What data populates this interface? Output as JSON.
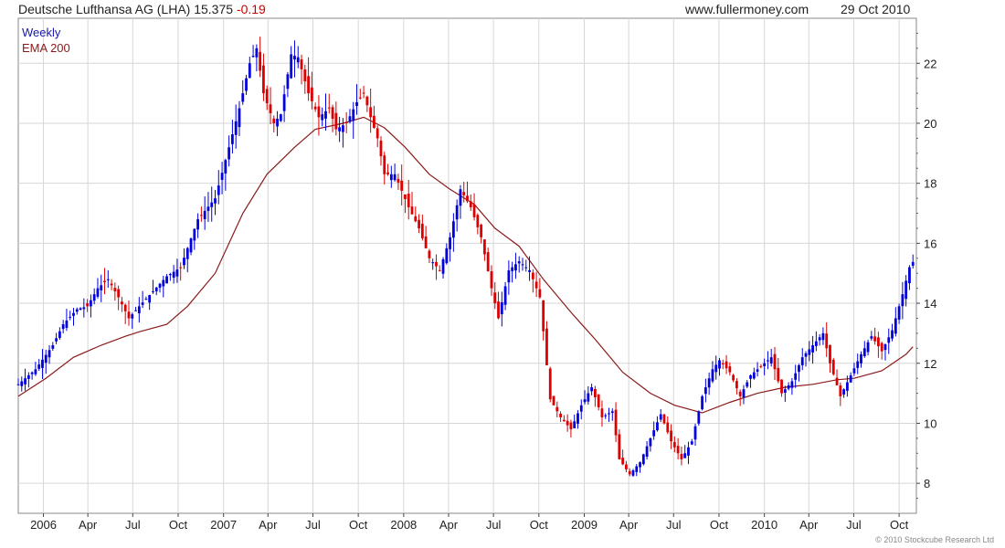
{
  "header": {
    "name": "Deutsche Lufthansa AG (LHA)",
    "price": "15.375",
    "change": "-0.19",
    "site": "www.fullermoney.com",
    "date": "29 Oct 2010"
  },
  "legend": {
    "weekly": "Weekly",
    "ema": "EMA 200"
  },
  "copyright": "© 2010 Stockcube Research Ltd",
  "colors": {
    "up": "#0000dd",
    "down": "#dd0000",
    "ema": "#8b1a1a",
    "grid": "#d6d6d6",
    "frame": "#888888"
  },
  "chart_data": {
    "type": "candlestick",
    "x_range": [
      "2005-11-11",
      "2010-11-05"
    ],
    "ylim": [
      7,
      23.5
    ],
    "y_ticks": [
      8,
      10,
      12,
      14,
      16,
      18,
      20,
      22
    ],
    "x_ticks": [
      {
        "label": "2006",
        "date": "2006-01-01"
      },
      {
        "label": "Apr",
        "date": "2006-04-01"
      },
      {
        "label": "Jul",
        "date": "2006-07-01"
      },
      {
        "label": "Oct",
        "date": "2006-10-01"
      },
      {
        "label": "2007",
        "date": "2007-01-01"
      },
      {
        "label": "Apr",
        "date": "2007-04-01"
      },
      {
        "label": "Jul",
        "date": "2007-07-01"
      },
      {
        "label": "Oct",
        "date": "2007-10-01"
      },
      {
        "label": "2008",
        "date": "2008-01-01"
      },
      {
        "label": "Apr",
        "date": "2008-04-01"
      },
      {
        "label": "Jul",
        "date": "2008-07-01"
      },
      {
        "label": "Oct",
        "date": "2008-10-01"
      },
      {
        "label": "2009",
        "date": "2009-01-01"
      },
      {
        "label": "Apr",
        "date": "2009-04-01"
      },
      {
        "label": "Jul",
        "date": "2009-07-01"
      },
      {
        "label": "Oct",
        "date": "2009-10-01"
      },
      {
        "label": "2010",
        "date": "2010-01-01"
      },
      {
        "label": "Apr",
        "date": "2010-04-01"
      },
      {
        "label": "Jul",
        "date": "2010-07-01"
      },
      {
        "label": "Oct",
        "date": "2010-10-01"
      }
    ],
    "price_path": [
      [
        "2005-11-11",
        11.3
      ],
      [
        "2005-12-16",
        11.8
      ],
      [
        "2006-01-20",
        12.6
      ],
      [
        "2006-02-10",
        13.3
      ],
      [
        "2006-03-10",
        13.8
      ],
      [
        "2006-03-31",
        13.9
      ],
      [
        "2006-04-21",
        14.5
      ],
      [
        "2006-05-12",
        14.8
      ],
      [
        "2006-06-02",
        14.2
      ],
      [
        "2006-06-23",
        13.5
      ],
      [
        "2006-07-14",
        13.9
      ],
      [
        "2006-08-11",
        14.4
      ],
      [
        "2006-09-08",
        14.9
      ],
      [
        "2006-10-06",
        15.2
      ],
      [
        "2006-11-10",
        16.8
      ],
      [
        "2006-12-15",
        17.5
      ],
      [
        "2007-01-12",
        19.2
      ],
      [
        "2007-02-02",
        20.5
      ],
      [
        "2007-02-23",
        22.0
      ],
      [
        "2007-03-09",
        22.5
      ],
      [
        "2007-03-23",
        21.0
      ],
      [
        "2007-04-13",
        20.0
      ],
      [
        "2007-04-27",
        20.3
      ],
      [
        "2007-05-18",
        22.3
      ],
      [
        "2007-06-01",
        22.2
      ],
      [
        "2007-06-22",
        21.0
      ],
      [
        "2007-07-13",
        20.2
      ],
      [
        "2007-08-03",
        20.5
      ],
      [
        "2007-08-17",
        19.8
      ],
      [
        "2007-09-07",
        20.0
      ],
      [
        "2007-09-28",
        20.7
      ],
      [
        "2007-10-12",
        21.0
      ],
      [
        "2007-10-26",
        20.2
      ],
      [
        "2007-11-09",
        19.5
      ],
      [
        "2007-11-23",
        18.3
      ],
      [
        "2007-12-14",
        18.3
      ],
      [
        "2008-01-11",
        17.2
      ],
      [
        "2008-02-01",
        16.5
      ],
      [
        "2008-02-22",
        15.5
      ],
      [
        "2008-03-14",
        15.1
      ],
      [
        "2008-04-04",
        16.2
      ],
      [
        "2008-04-25",
        17.8
      ],
      [
        "2008-05-16",
        17.2
      ],
      [
        "2008-06-06",
        16.2
      ],
      [
        "2008-06-27",
        14.5
      ],
      [
        "2008-07-11",
        13.5
      ],
      [
        "2008-08-01",
        15.1
      ],
      [
        "2008-08-22",
        15.4
      ],
      [
        "2008-09-12",
        15.1
      ],
      [
        "2008-10-03",
        14.2
      ],
      [
        "2008-10-24",
        10.8
      ],
      [
        "2008-11-14",
        10.2
      ],
      [
        "2008-12-05",
        9.8
      ],
      [
        "2008-12-26",
        10.6
      ],
      [
        "2009-01-16",
        11.2
      ],
      [
        "2009-02-06",
        10.2
      ],
      [
        "2009-02-27",
        10.4
      ],
      [
        "2009-03-13",
        8.8
      ],
      [
        "2009-04-03",
        8.3
      ],
      [
        "2009-04-24",
        8.7
      ],
      [
        "2009-05-15",
        9.5
      ],
      [
        "2009-06-05",
        10.3
      ],
      [
        "2009-06-26",
        9.4
      ],
      [
        "2009-07-17",
        8.8
      ],
      [
        "2009-08-07",
        9.4
      ],
      [
        "2009-08-28",
        10.9
      ],
      [
        "2009-09-18",
        11.8
      ],
      [
        "2009-10-02",
        12.1
      ],
      [
        "2009-10-23",
        11.7
      ],
      [
        "2009-11-13",
        10.9
      ],
      [
        "2009-12-04",
        11.6
      ],
      [
        "2009-12-25",
        11.9
      ],
      [
        "2010-01-15",
        12.2
      ],
      [
        "2010-02-05",
        11.0
      ],
      [
        "2010-02-26",
        11.4
      ],
      [
        "2010-03-19",
        12.2
      ],
      [
        "2010-04-09",
        12.6
      ],
      [
        "2010-04-30",
        13.0
      ],
      [
        "2010-05-14",
        12.0
      ],
      [
        "2010-06-04",
        10.9
      ],
      [
        "2010-06-25",
        11.6
      ],
      [
        "2010-07-16",
        12.3
      ],
      [
        "2010-08-06",
        12.9
      ],
      [
        "2010-08-27",
        12.4
      ],
      [
        "2010-09-17",
        13.1
      ],
      [
        "2010-10-08",
        14.3
      ],
      [
        "2010-10-22",
        15.2
      ],
      [
        "2010-10-29",
        15.375
      ]
    ],
    "ema_200": [
      [
        "2005-11-11",
        10.9
      ],
      [
        "2006-01-06",
        11.5
      ],
      [
        "2006-03-03",
        12.2
      ],
      [
        "2006-04-28",
        12.6
      ],
      [
        "2006-06-16",
        12.9
      ],
      [
        "2006-07-14",
        13.05
      ],
      [
        "2006-09-08",
        13.3
      ],
      [
        "2006-10-20",
        13.9
      ],
      [
        "2006-12-15",
        15.0
      ],
      [
        "2007-02-09",
        17.0
      ],
      [
        "2007-03-30",
        18.3
      ],
      [
        "2007-05-25",
        19.2
      ],
      [
        "2007-07-06",
        19.8
      ],
      [
        "2007-08-31",
        20.0
      ],
      [
        "2007-10-12",
        20.2
      ],
      [
        "2007-11-23",
        19.85
      ],
      [
        "2008-01-04",
        19.2
      ],
      [
        "2008-02-22",
        18.3
      ],
      [
        "2008-04-04",
        17.8
      ],
      [
        "2008-05-23",
        17.3
      ],
      [
        "2008-07-04",
        16.5
      ],
      [
        "2008-08-22",
        15.9
      ],
      [
        "2008-10-10",
        14.8
      ],
      [
        "2008-12-05",
        13.7
      ],
      [
        "2009-01-23",
        12.8
      ],
      [
        "2009-03-20",
        11.7
      ],
      [
        "2009-05-15",
        11.0
      ],
      [
        "2009-07-03",
        10.6
      ],
      [
        "2009-08-28",
        10.35
      ],
      [
        "2009-10-23",
        10.7
      ],
      [
        "2009-12-18",
        11.0
      ],
      [
        "2010-02-12",
        11.2
      ],
      [
        "2010-04-09",
        11.3
      ],
      [
        "2010-05-28",
        11.45
      ],
      [
        "2010-07-02",
        11.5
      ],
      [
        "2010-08-27",
        11.75
      ],
      [
        "2010-10-15",
        12.3
      ],
      [
        "2010-10-29",
        12.55
      ]
    ]
  }
}
